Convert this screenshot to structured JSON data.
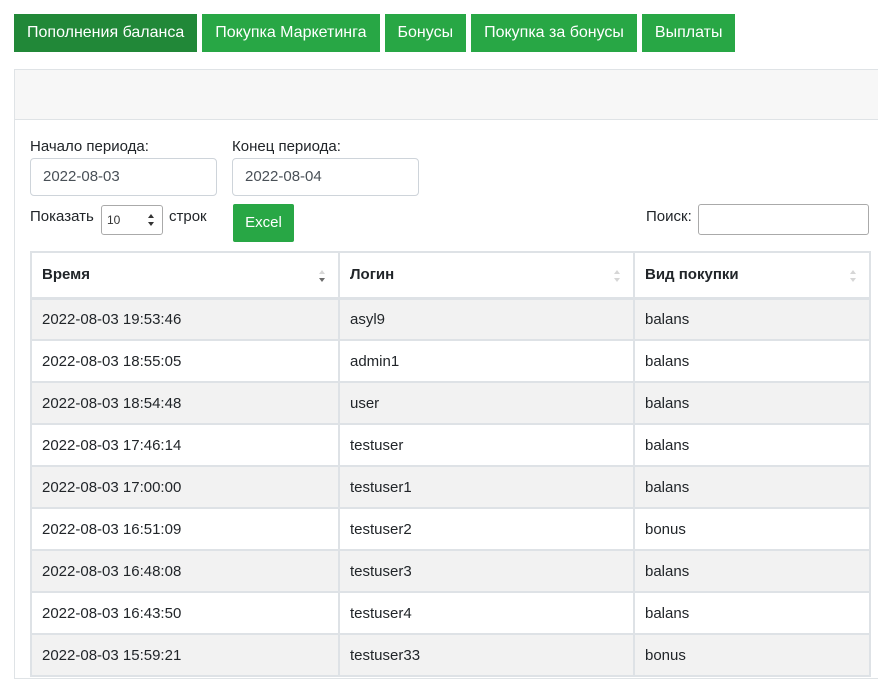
{
  "tabs": [
    {
      "label": "Пополнения баланса",
      "active": true
    },
    {
      "label": "Покупка Маркетинга",
      "active": false
    },
    {
      "label": "Бонусы",
      "active": false
    },
    {
      "label": "Покупка за бонусы",
      "active": false
    },
    {
      "label": "Выплаты",
      "active": false
    }
  ],
  "filters": {
    "start_label": "Начало периода:",
    "start_value": "2022-08-03",
    "end_label": "Конец периода:",
    "end_value": "2022-08-04",
    "show_label": "Показать",
    "rows_value": "10",
    "rows_suffix": "строк",
    "excel_label": "Excel",
    "search_label": "Поиск:",
    "search_value": ""
  },
  "table": {
    "columns": [
      "Время",
      "Логин",
      "Вид покупки"
    ],
    "rows": [
      [
        "2022-08-03 19:53:46",
        "asyl9",
        "balans"
      ],
      [
        "2022-08-03 18:55:05",
        "admin1",
        "balans"
      ],
      [
        "2022-08-03 18:54:48",
        "user",
        "balans"
      ],
      [
        "2022-08-03 17:46:14",
        "testuser",
        "balans"
      ],
      [
        "2022-08-03 17:00:00",
        "testuser1",
        "balans"
      ],
      [
        "2022-08-03 16:51:09",
        "testuser2",
        "bonus"
      ],
      [
        "2022-08-03 16:48:08",
        "testuser3",
        "balans"
      ],
      [
        "2022-08-03 16:43:50",
        "testuser4",
        "balans"
      ],
      [
        "2022-08-03 15:59:21",
        "testuser33",
        "bonus"
      ]
    ]
  },
  "colors": {
    "accent": "#28a745",
    "accent_active": "#218838",
    "stripe": "#f2f2f2",
    "border": "#dee2e6"
  }
}
